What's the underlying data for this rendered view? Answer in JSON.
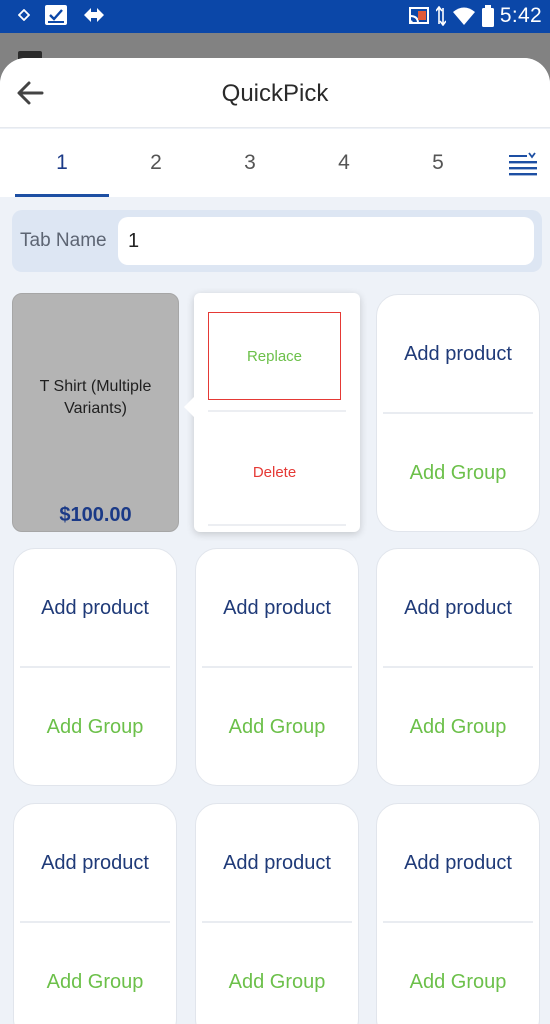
{
  "status_bar": {
    "time": "5:42",
    "left_icons": [
      "notification-dot-icon",
      "checkbox-icon",
      "diamond-arrows-icon"
    ],
    "right_icons": [
      "cast-icon",
      "data-arrows-icon",
      "wifi-icon",
      "battery-icon"
    ]
  },
  "header": {
    "title": "QuickPick",
    "back_icon": "arrow-left-icon"
  },
  "tabs": {
    "items": [
      "1",
      "2",
      "3",
      "4",
      "5"
    ],
    "active_index": 0,
    "menu_icon": "sort-list-icon"
  },
  "tab_name": {
    "label": "Tab Name",
    "value": "1"
  },
  "product": {
    "name": "T Shirt (Multiple Variants)",
    "price": "$100.00"
  },
  "popup": {
    "replace_label": "Replace",
    "delete_label": "Delete"
  },
  "cell": {
    "add_product": "Add product",
    "add_group": "Add Group"
  },
  "colors": {
    "status_bar": "#0b47a8",
    "primary_text": "#1f3a78",
    "green": "#6cc04a",
    "red": "#e53935"
  }
}
